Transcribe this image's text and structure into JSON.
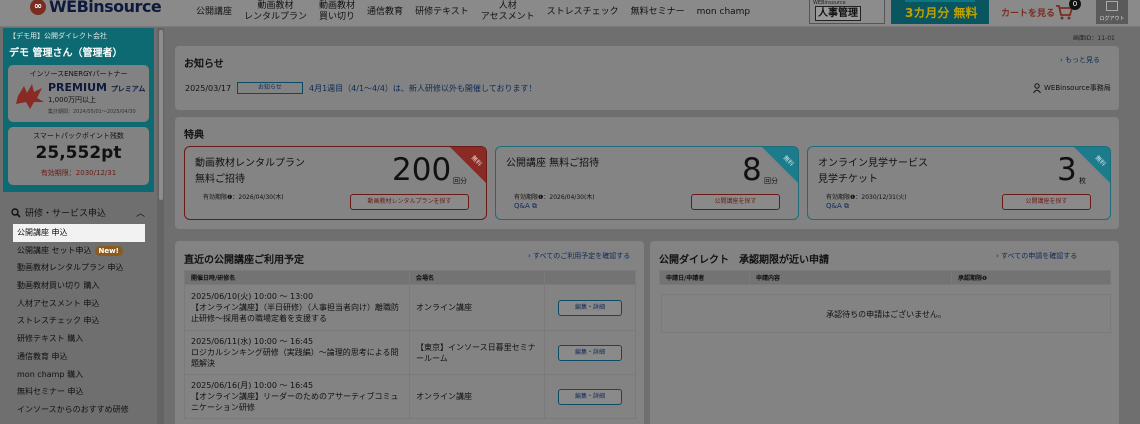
{
  "header": {
    "logo_text": "WEBinsource",
    "nav": [
      {
        "label": "公開講座"
      },
      {
        "label": "動画教材\nレンタルプラン"
      },
      {
        "label": "動画教材\n買い切り"
      },
      {
        "label": "通信教育"
      },
      {
        "label": "研修テキスト"
      },
      {
        "label": "人材\nアセスメント"
      },
      {
        "label": "ストレスチェック"
      },
      {
        "label": "無料セミナー"
      },
      {
        "label": "mon champ"
      }
    ],
    "jinji_small": "WEBinsource",
    "jinji_label": "人事管理",
    "free_banner": "3カ月分 無料",
    "cart_label": "カートを見る",
    "cart_count": "0",
    "logout_label": "ログアウト"
  },
  "sidebar": {
    "company": "【デモ用】公開ダイレクト会社",
    "admin_name": "デモ 管理さん（管理者）",
    "partner_label": "インソースENERGYパートナー",
    "premium_title": "PREMIUM",
    "premium_sub": "プレミアム",
    "premium_amount": "1,000万円以上",
    "premium_period": "集計期間：2024/05/01～2025/04/30",
    "points_label": "スマートパックポイント残数",
    "points_value": "25,552pt",
    "points_expiry": "有効期限：2030/12/31",
    "service_heading": "研修・サービス申込",
    "menu": [
      {
        "label": "公開講座 申込"
      },
      {
        "label": "公開講座 セット申込",
        "badge": "New!"
      },
      {
        "label": "動画教材レンタルプラン 申込"
      },
      {
        "label": "動画教材買い切り 購入"
      },
      {
        "label": "人材アセスメント 申込"
      },
      {
        "label": "ストレスチェック 申込"
      },
      {
        "label": "研修テキスト 購入"
      },
      {
        "label": "通信教育 申込"
      },
      {
        "label": "mon champ 購入"
      },
      {
        "label": "無料セミナー 申込"
      },
      {
        "label": "インソースからのおすすめ研修"
      }
    ]
  },
  "main": {
    "screen_id": "画面ID：11-01",
    "notice": {
      "title": "お知らせ",
      "more_link": "もっと見る",
      "date": "2025/03/17",
      "badge": "お知らせ",
      "text": "4月1週目（4/1～4/4）は、新人研修以外も開催しております！",
      "office": "WEBinsource事務局"
    },
    "perks": {
      "title": "特典",
      "cards": [
        {
          "title": "動画教材レンタルプラン\n無料ご招待",
          "number": "200",
          "unit": "回分",
          "ribbon": "無料",
          "expiry": "有効期限❶：2026/04/30(木)",
          "qa": "",
          "button": "動画教材レンタルプランを探す"
        },
        {
          "title": "公開講座 無料ご招待",
          "number": "8",
          "unit": "回分",
          "ribbon": "無料",
          "expiry": "有効期限❶：2026/04/30(木)",
          "qa": "Q&A",
          "button": "公開講座を探す"
        },
        {
          "title": "オンライン見学サービス\n見学チケット",
          "number": "3",
          "unit": "枚",
          "ribbon": "無料",
          "expiry": "有効期限❶：2030/12/31(火)",
          "qa": "Q&A",
          "button": "公開講座を探す"
        }
      ]
    },
    "schedule": {
      "title": "直近の公開講座ご利用予定",
      "link": "すべてのご利用予定を確認する",
      "headers": [
        "開催日時/研修名",
        "会場名",
        ""
      ],
      "rows": [
        {
          "when": "2025/06/10(火) 10:00 ～ 13:00",
          "name": "【オンライン講座】（半日研修）（人事担当者向け）離職防止研修～採用者の職場定着を支援する",
          "venue": "オンライン講座",
          "button": "編集・詳細"
        },
        {
          "when": "2025/06/11(水) 10:00 ～ 16:45",
          "name": "ロジカルシンキング研修（実践編）～論理的思考による問題解決",
          "venue": "【東京】インソース日暮里セミナールーム",
          "button": "編集・詳細"
        },
        {
          "when": "2025/06/16(月) 10:00 ～ 16:45",
          "name": "【オンライン講座】リーダーのためのアサーティブコミュニケーション研修",
          "venue": "オンライン講座",
          "button": "編集・詳細"
        }
      ]
    },
    "approval": {
      "title": "公開ダイレクト　承認期限が近い申請",
      "link": "すべての申請を確認する",
      "headers": [
        "申請日/申請者",
        "申請内容",
        "承認期限❶"
      ],
      "empty_message": "承認待ちの申請はございません。"
    }
  },
  "colors": {
    "overlay_gray": "#6f6f6f",
    "teal": "#0d6a72",
    "brand_red": "#7a2c20",
    "ribbon_red": "#8a2a24",
    "ribbon_teal": "#1c7c8c"
  }
}
